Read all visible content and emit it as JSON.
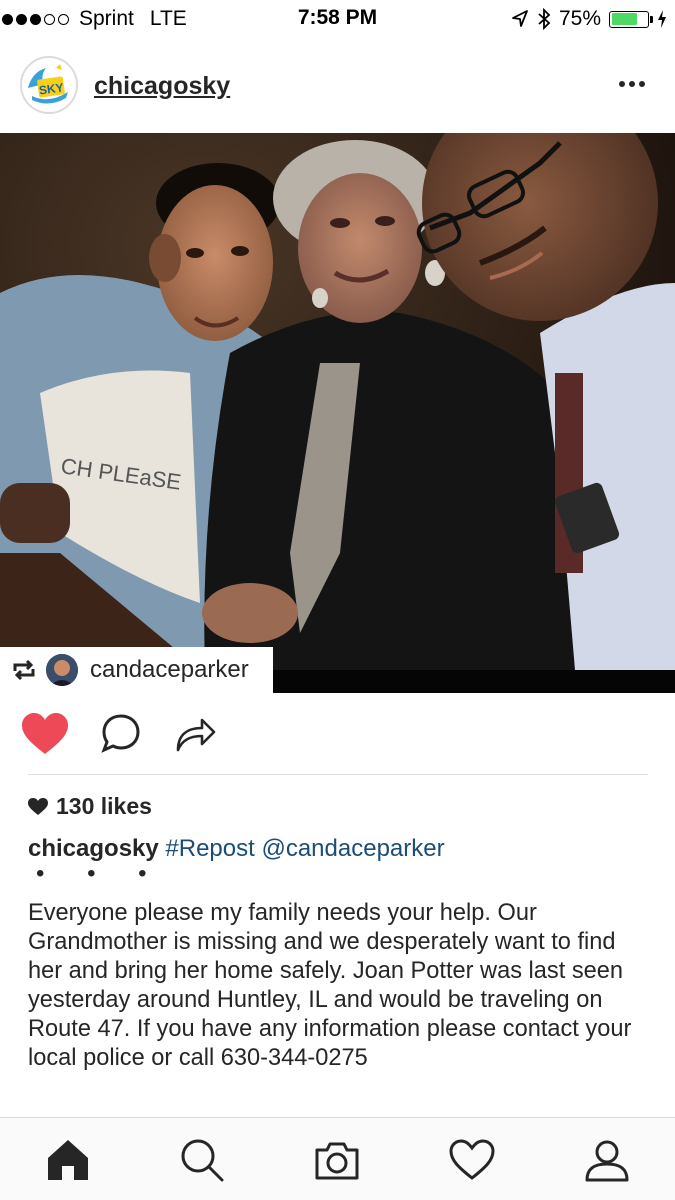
{
  "status_bar": {
    "carrier": "Sprint",
    "network": "LTE",
    "time": "7:58 PM",
    "battery_percent": "75%",
    "battery_level": 0.75,
    "signal_bars": 3
  },
  "post": {
    "username": "chicagosky",
    "avatar_text": "SKY",
    "repost_user": "candaceparker",
    "likes": "130 likes",
    "caption_user": "chicagosky",
    "caption_hashtag": "#Repost",
    "caption_mention": "@candaceparker",
    "caption_dots": "• • •",
    "caption_body": "Everyone please my family needs your help. Our Grandmother is missing and we desperately want to find her and bring her home safely. Joan Potter was last seen yesterday around Huntley, IL and would be traveling on Route 47. If you have any information please contact your local police or call 630-344-0275",
    "shirt_text": "CH PLEaSE",
    "liked": true
  },
  "colors": {
    "heart_red": "#ed4956",
    "link_blue": "#1b4d7a",
    "battery_green": "#4cd964",
    "sky_yellow": "#f7d117",
    "sky_blue": "#3aa0dc"
  },
  "icons": [
    "heart-icon",
    "comment-icon",
    "share-icon",
    "more-icon",
    "repost-icon",
    "home-icon",
    "search-icon",
    "camera-icon",
    "activity-icon",
    "profile-icon",
    "location-icon",
    "bluetooth-icon"
  ]
}
